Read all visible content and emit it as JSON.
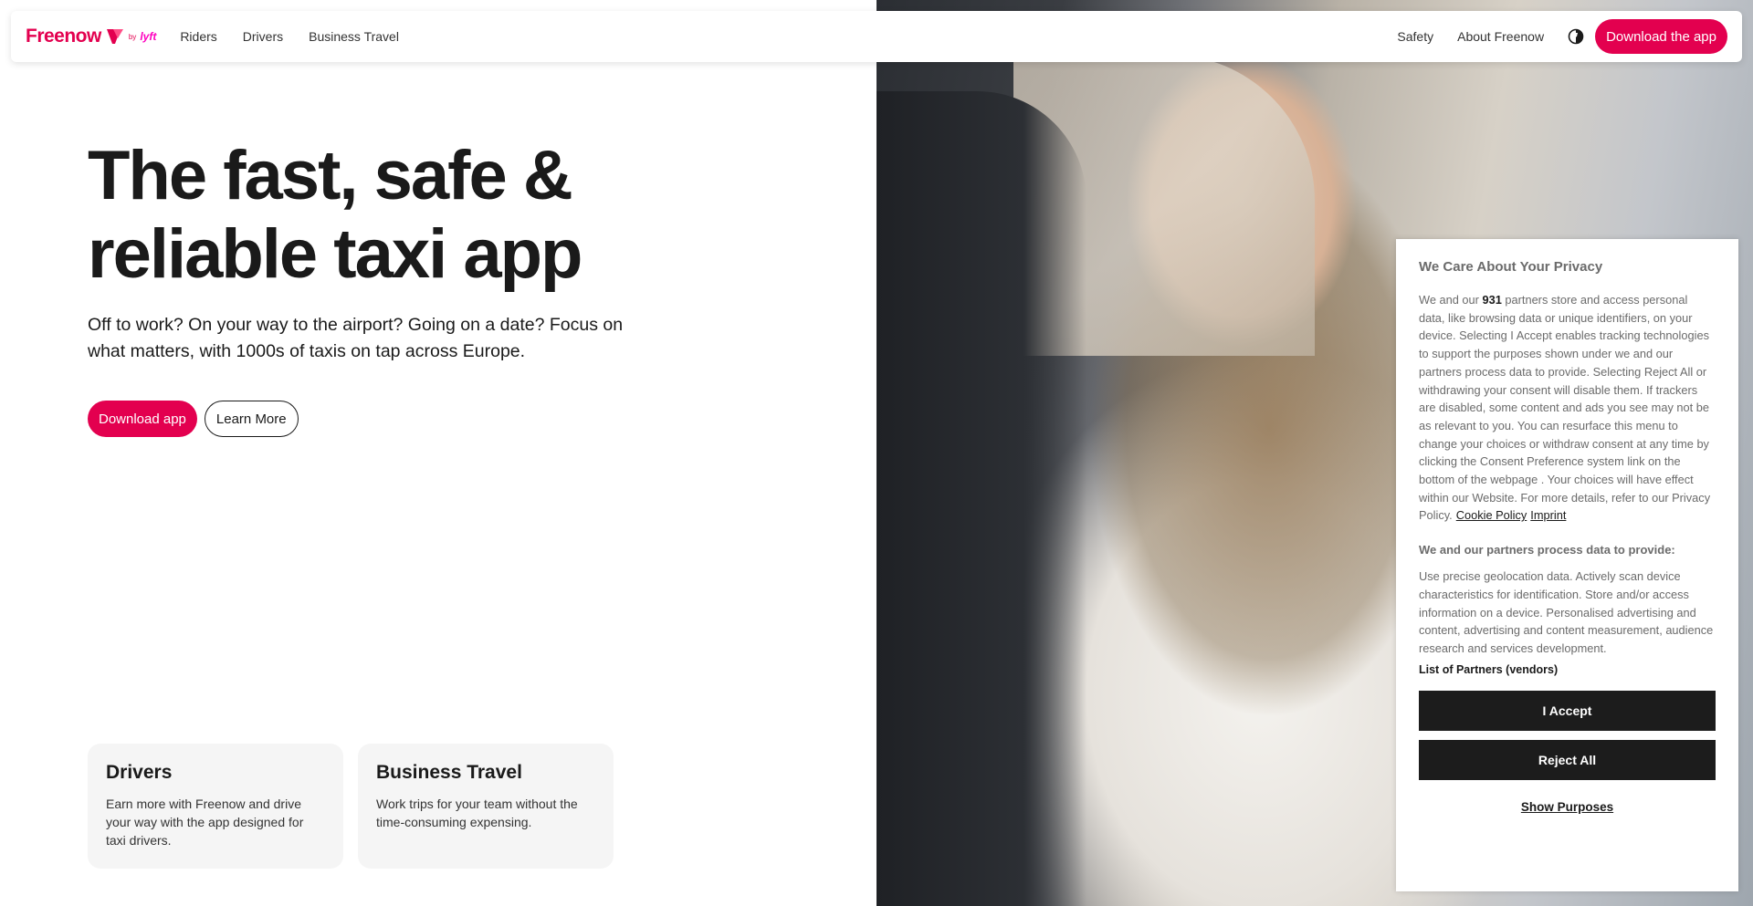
{
  "nav": {
    "logo_text": "Freenow",
    "logo_by": "by",
    "logo_lyft": "lyft",
    "links_left": [
      "Riders",
      "Drivers",
      "Business Travel"
    ],
    "links_right": [
      "Safety",
      "About Freenow"
    ],
    "download_label": "Download the app"
  },
  "hero": {
    "title_line1": "The fast, safe &",
    "title_line2": "reliable taxi app",
    "subtitle": "Off to work? On your way to the airport? Going on a date? Focus on what matters, with 1000s of taxis on tap across Europe.",
    "primary_button": "Download app",
    "secondary_button": "Learn More"
  },
  "cards": [
    {
      "title": "Drivers",
      "text": "Earn more with Freenow and drive your way with the app designed for taxi drivers."
    },
    {
      "title": "Business Travel",
      "text": "Work trips for your team without the time-consuming expensing."
    }
  ],
  "privacy": {
    "title": "We Care About Your Privacy",
    "body_prefix": "We and our ",
    "partner_count": "931",
    "body_main": " partners store and access personal data, like browsing data or unique identifiers, on your device. Selecting I Accept enables tracking technologies to support the purposes shown under we and our partners process data to provide. Selecting Reject All or withdrawing your consent will disable them. If trackers are disabled, some content and ads you see may not be as relevant to you. You can resurface this menu to change your choices or withdraw consent at any time by clicking the Consent Preference system link on the bottom of the webpage . Your choices will have effect within our Website. For more details, refer to our Privacy Policy.",
    "cookie_policy": "Cookie Policy",
    "imprint": "Imprint",
    "purposes_title": "We and our partners process data to provide:",
    "purposes_text": "Use precise geolocation data. Actively scan device characteristics for identification. Store and/or access information on a device. Personalised advertising and content, advertising and content measurement, audience research and services development.",
    "partners_link": "List of Partners (vendors)",
    "accept_label": "I Accept",
    "reject_label": "Reject All",
    "show_purposes_label": "Show Purposes"
  },
  "colors": {
    "brand": "#e3004f",
    "dark_button": "#1c1c1c"
  }
}
